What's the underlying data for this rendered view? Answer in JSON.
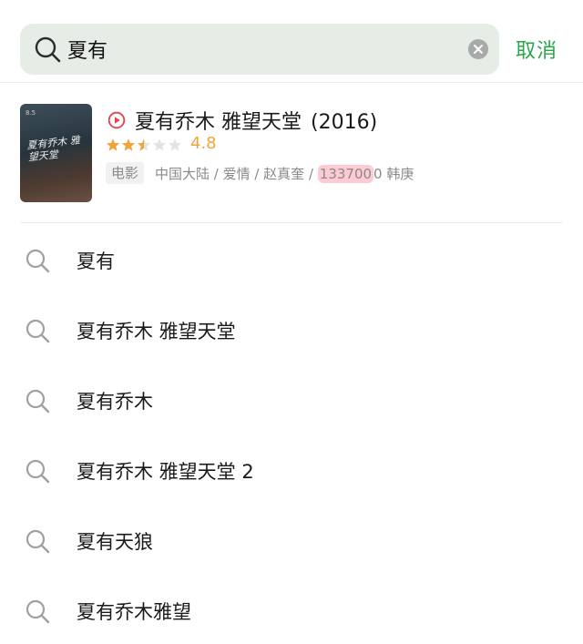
{
  "search": {
    "value": "夏有",
    "cancel_label": "取消"
  },
  "movie": {
    "title": "夏有乔木 雅望天堂",
    "year": "(2016)",
    "rating": "4.8",
    "star_rating_of_5": 2.5,
    "type_badge": "电影",
    "meta_prefix": "中国大陆 / 爱情 / 赵真奎 / ",
    "meta_highlight": "133700",
    "meta_suffix": "0 韩庚",
    "poster_top_text": "8.5",
    "poster_title": "夏有乔木 雅望天堂"
  },
  "suggestions": [
    "夏有",
    "夏有乔木 雅望天堂",
    "夏有乔木",
    "夏有乔木 雅望天堂 2",
    "夏有天狼",
    "夏有乔木雅望"
  ],
  "colors": {
    "accent_green": "#2aa64a",
    "star_orange": "#f2a33a",
    "play_red": "#e8414a",
    "search_bg": "#e6ece6",
    "highlight_pink": "#ffa0af"
  }
}
